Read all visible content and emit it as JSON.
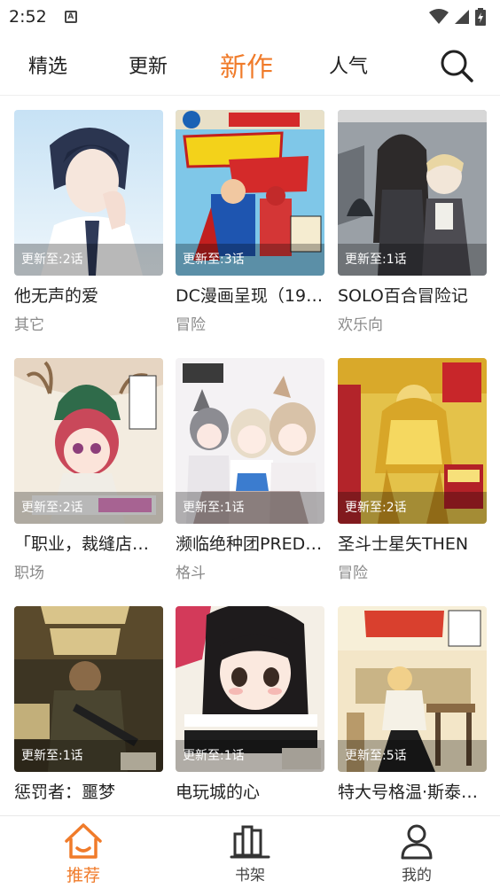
{
  "status_bar": {
    "time": "2:52",
    "notification_icon": "A"
  },
  "tabs": [
    {
      "label": "精选",
      "active": false
    },
    {
      "label": "更新",
      "active": false
    },
    {
      "label": "新作",
      "active": true
    },
    {
      "label": "人气",
      "active": false
    }
  ],
  "colors": {
    "accent": "#f07b2a",
    "text": "#222222",
    "muted": "#8a8a8a"
  },
  "comics": [
    {
      "title": "他无声的爱",
      "update": "更新至:2话",
      "genre": "其它",
      "cover_icon": "cover-boy-portrait"
    },
    {
      "title": "DC漫画呈现（19…",
      "update": "更新至:3话",
      "genre": "冒险",
      "cover_icon": "cover-superman-flash"
    },
    {
      "title": "SOLO百合冒险记",
      "update": "更新至:1话",
      "genre": "欢乐向",
      "cover_icon": "cover-two-girls-castle"
    },
    {
      "title": "「职业，裁缝店…",
      "update": "更新至:2话",
      "genre": "职场",
      "cover_icon": "cover-antler-girl"
    },
    {
      "title": "濒临绝种团PRED…",
      "update": "更新至:1话",
      "genre": "格斗",
      "cover_icon": "cover-animal-girls"
    },
    {
      "title": "圣斗士星矢THEN",
      "update": "更新至:2话",
      "genre": "冒险",
      "cover_icon": "cover-gold-saint"
    },
    {
      "title": "惩罚者：噩梦",
      "update": "更新至:1话",
      "genre": "",
      "cover_icon": "cover-punisher"
    },
    {
      "title": "电玩城的心",
      "update": "更新至:1话",
      "genre": "",
      "cover_icon": "cover-black-hair-girl"
    },
    {
      "title": "特大号格温·斯泰…",
      "update": "更新至:5话",
      "genre": "",
      "cover_icon": "cover-gwen-stacy"
    }
  ],
  "bottom_nav": [
    {
      "label": "推荐",
      "icon": "home-icon",
      "active": true
    },
    {
      "label": "书架",
      "icon": "bookshelf-icon",
      "active": false
    },
    {
      "label": "我的",
      "icon": "user-icon",
      "active": false
    }
  ]
}
